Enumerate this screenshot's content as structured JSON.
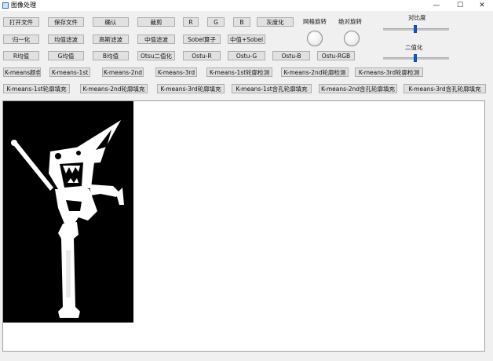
{
  "window": {
    "title": "图像处理",
    "minimize": "—",
    "maximize": "☐",
    "close": "✕"
  },
  "row1": {
    "open_file": "打开文件",
    "save_file": "保存文件",
    "confirm": "确认",
    "crop": "裁剪",
    "r": "R",
    "g": "G",
    "b": "B",
    "gray": "灰度化",
    "grid_rotate_label": "网格旋转",
    "absolute_rotate_label": "绝对旋转",
    "contrast_label": "对比度"
  },
  "row2": {
    "normalize": "归一化",
    "mean_filter": "均值滤波",
    "gauss_filter": "高斯滤波",
    "median_filter": "中值滤波",
    "sobel": "Sobel算子",
    "median_sobel": "中值+Sobel",
    "binarize_label": "二值化"
  },
  "row3": {
    "r_mean": "R均值",
    "g_mean": "G均值",
    "b_mean": "B均值",
    "otsu_binary": "Otsu二值化",
    "otsu_r": "Ostu-R",
    "otsu_g": "Ostu-G",
    "otsu_b": "Ostu-B",
    "otsu_rgb": "Ostu-RGB"
  },
  "row4": {
    "kmeans_color": "K-means颜色",
    "kmeans_1st": "K-means-1st",
    "kmeans_2nd": "K-means-2nd",
    "kmeans_3rd": "K-means-3rd",
    "kmeans_1st_contour": "K-means-1st轮廓检测",
    "kmeans_2nd_contour": "K-means-2nd轮廓检测",
    "kmeans_3rd_contour": "K-means-3rd轮廓检测"
  },
  "row5": {
    "kmeans_1st_fill": "K-means-1st轮廓填充",
    "kmeans_2nd_fill": "K-means-2nd轮廓填充",
    "kmeans_3rd_fill": "K-means-3rd轮廓填充",
    "kmeans_1st_hole_fill": "K-means-1st含孔轮廓填充",
    "kmeans_2nd_hole_fill": "K-means-2nd含孔轮廓填充",
    "kmeans_3rd_hole_fill": "K-means-3rd含孔轮廓填充"
  },
  "sliders": {
    "contrast_value": 0.5,
    "binarize_value": 0.5
  },
  "colors": {
    "slider_handle": "#0a5bd3",
    "image_background": "#000000"
  }
}
